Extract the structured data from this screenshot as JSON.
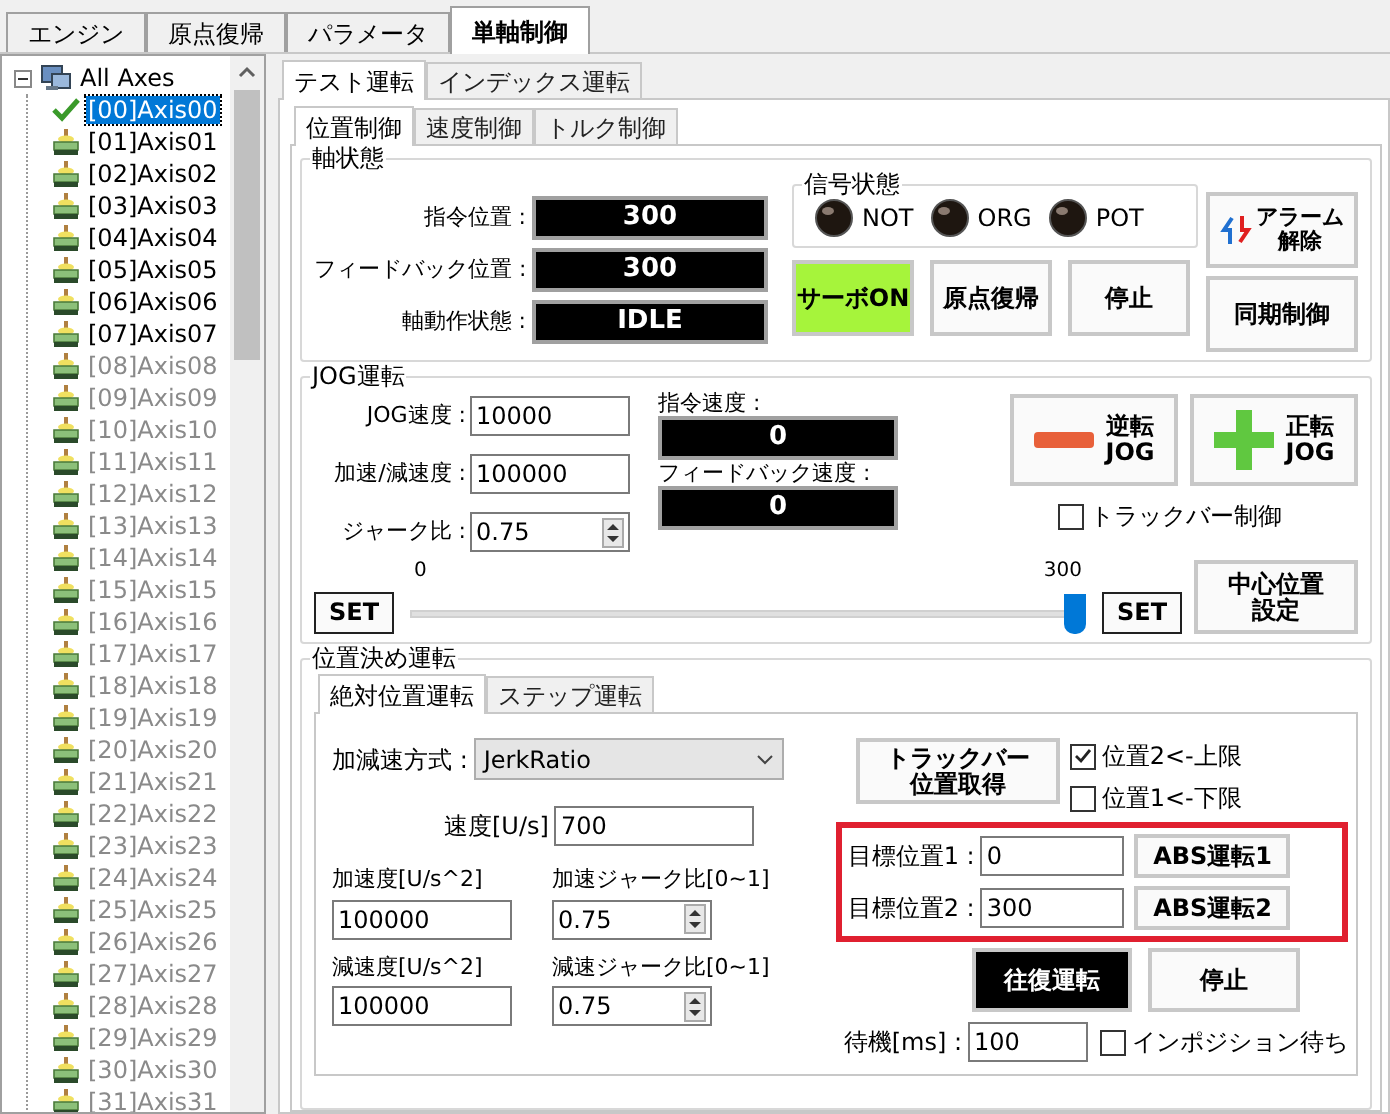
{
  "main_tabs": [
    {
      "label": "エンジン",
      "selected": false
    },
    {
      "label": "原点復帰",
      "selected": false
    },
    {
      "label": "パラメータ",
      "selected": false
    },
    {
      "label": "単軸制御",
      "selected": true
    }
  ],
  "axis_tree": {
    "label": "All Axes",
    "expanded": true,
    "children": [
      {
        "label": "[00]Axis00",
        "selected": true,
        "disabled": false
      },
      {
        "label": "[01]Axis01",
        "selected": false,
        "disabled": false
      },
      {
        "label": "[02]Axis02",
        "selected": false,
        "disabled": false
      },
      {
        "label": "[03]Axis03",
        "selected": false,
        "disabled": false
      },
      {
        "label": "[04]Axis04",
        "selected": false,
        "disabled": false
      },
      {
        "label": "[05]Axis05",
        "selected": false,
        "disabled": false
      },
      {
        "label": "[06]Axis06",
        "selected": false,
        "disabled": false
      },
      {
        "label": "[07]Axis07",
        "selected": false,
        "disabled": false
      },
      {
        "label": "[08]Axis08",
        "selected": false,
        "disabled": true
      },
      {
        "label": "[09]Axis09",
        "selected": false,
        "disabled": true
      },
      {
        "label": "[10]Axis10",
        "selected": false,
        "disabled": true
      },
      {
        "label": "[11]Axis11",
        "selected": false,
        "disabled": true
      },
      {
        "label": "[12]Axis12",
        "selected": false,
        "disabled": true
      },
      {
        "label": "[13]Axis13",
        "selected": false,
        "disabled": true
      },
      {
        "label": "[14]Axis14",
        "selected": false,
        "disabled": true
      },
      {
        "label": "[15]Axis15",
        "selected": false,
        "disabled": true
      },
      {
        "label": "[16]Axis16",
        "selected": false,
        "disabled": true
      },
      {
        "label": "[17]Axis17",
        "selected": false,
        "disabled": true
      },
      {
        "label": "[18]Axis18",
        "selected": false,
        "disabled": true
      },
      {
        "label": "[19]Axis19",
        "selected": false,
        "disabled": true
      },
      {
        "label": "[20]Axis20",
        "selected": false,
        "disabled": true
      },
      {
        "label": "[21]Axis21",
        "selected": false,
        "disabled": true
      },
      {
        "label": "[22]Axis22",
        "selected": false,
        "disabled": true
      },
      {
        "label": "[23]Axis23",
        "selected": false,
        "disabled": true
      },
      {
        "label": "[24]Axis24",
        "selected": false,
        "disabled": true
      },
      {
        "label": "[25]Axis25",
        "selected": false,
        "disabled": true
      },
      {
        "label": "[26]Axis26",
        "selected": false,
        "disabled": true
      },
      {
        "label": "[27]Axis27",
        "selected": false,
        "disabled": true
      },
      {
        "label": "[28]Axis28",
        "selected": false,
        "disabled": true
      },
      {
        "label": "[29]Axis29",
        "selected": false,
        "disabled": true
      },
      {
        "label": "[30]Axis30",
        "selected": false,
        "disabled": true
      },
      {
        "label": "[31]Axis31",
        "selected": false,
        "disabled": true
      }
    ]
  },
  "mode_tabs": [
    {
      "label": "テスト運転",
      "selected": true
    },
    {
      "label": "インデックス運転",
      "selected": false
    }
  ],
  "control_tabs": [
    {
      "label": "位置制御",
      "selected": true
    },
    {
      "label": "速度制御",
      "selected": false
    },
    {
      "label": "トルク制御",
      "selected": false
    }
  ],
  "axis_status": {
    "title": "軸状態",
    "readouts": [
      {
        "label": "指令位置 :",
        "value": "300"
      },
      {
        "label": "フィードバック位置 :",
        "value": "300"
      },
      {
        "label": "軸動作状態 :",
        "value": "IDLE"
      }
    ],
    "signals": {
      "title": "信号状態",
      "lamps": [
        {
          "label": "NOT",
          "on": false
        },
        {
          "label": "ORG",
          "on": false
        },
        {
          "label": "POT",
          "on": false
        }
      ]
    },
    "servo_button": {
      "label": "サーボON",
      "on": true
    },
    "buttons": [
      {
        "label": "原点復帰"
      },
      {
        "label": "停止"
      }
    ],
    "alarm_button": {
      "lines": [
        "アラーム",
        "解除"
      ]
    },
    "sync_button": {
      "label": "同期制御"
    }
  },
  "jog": {
    "title": "JOG運転",
    "fields": [
      {
        "label": "JOG速度 :",
        "value": "10000",
        "kind": "text"
      },
      {
        "label": "加速/減速度 :",
        "value": "100000",
        "kind": "text"
      },
      {
        "label": "ジャーク比 :",
        "value": "0.75",
        "kind": "spin"
      }
    ],
    "readouts": [
      {
        "label": "指令速度 :",
        "value": "0"
      },
      {
        "label": "フィードバック速度 :",
        "value": "0"
      }
    ],
    "buttons": [
      {
        "lines": [
          "逆転",
          "JOG"
        ],
        "kind": "minus"
      },
      {
        "lines": [
          "正転",
          "JOG"
        ],
        "kind": "plus"
      }
    ],
    "trackbar_control": {
      "label": "トラックバー制御",
      "checked": false
    },
    "slider": {
      "min_label": "0",
      "max_label": "300",
      "level": 1
    },
    "set_buttons": [
      "SET",
      "SET"
    ],
    "center_button": {
      "lines": [
        "中心位置",
        "設定"
      ]
    }
  },
  "positioning": {
    "title": "位置決め運転",
    "tabs": [
      {
        "label": "絶対位置運転",
        "selected": true
      },
      {
        "label": "ステップ運転",
        "selected": false
      }
    ],
    "accel_mode": {
      "label": "加減速方式 :",
      "value": "JerkRatio"
    },
    "speed": {
      "label": "速度[U/s]",
      "value": "700"
    },
    "params": [
      {
        "label": "加速度[U/s^2]",
        "value": "100000",
        "kind": "text"
      },
      {
        "label": "加速ジャーク比[0~1]",
        "value": "0.75",
        "kind": "spin"
      },
      {
        "label": "減速度[U/s^2]",
        "value": "100000",
        "kind": "text"
      },
      {
        "label": "減速ジャーク比[0~1]",
        "value": "0.75",
        "kind": "spin"
      }
    ],
    "trackbar_button": {
      "lines": [
        "トラックバー",
        "位置取得"
      ]
    },
    "limit_checks": [
      {
        "label": "位置2<-上限",
        "checked": true
      },
      {
        "label": "位置1<-下限",
        "checked": false
      }
    ],
    "targets": [
      {
        "label": "目標位置1 :",
        "value": "0",
        "button": "ABS運転1"
      },
      {
        "label": "目標位置2 :",
        "value": "300",
        "button": "ABS運転2"
      }
    ],
    "reciprocate_button": {
      "label": "往復運転",
      "active": true
    },
    "stop_button": {
      "label": "停止"
    },
    "wait": {
      "label": "待機[ms] :",
      "value": "100"
    },
    "inposition_check": {
      "label": "インポジション待ち",
      "checked": false
    }
  }
}
